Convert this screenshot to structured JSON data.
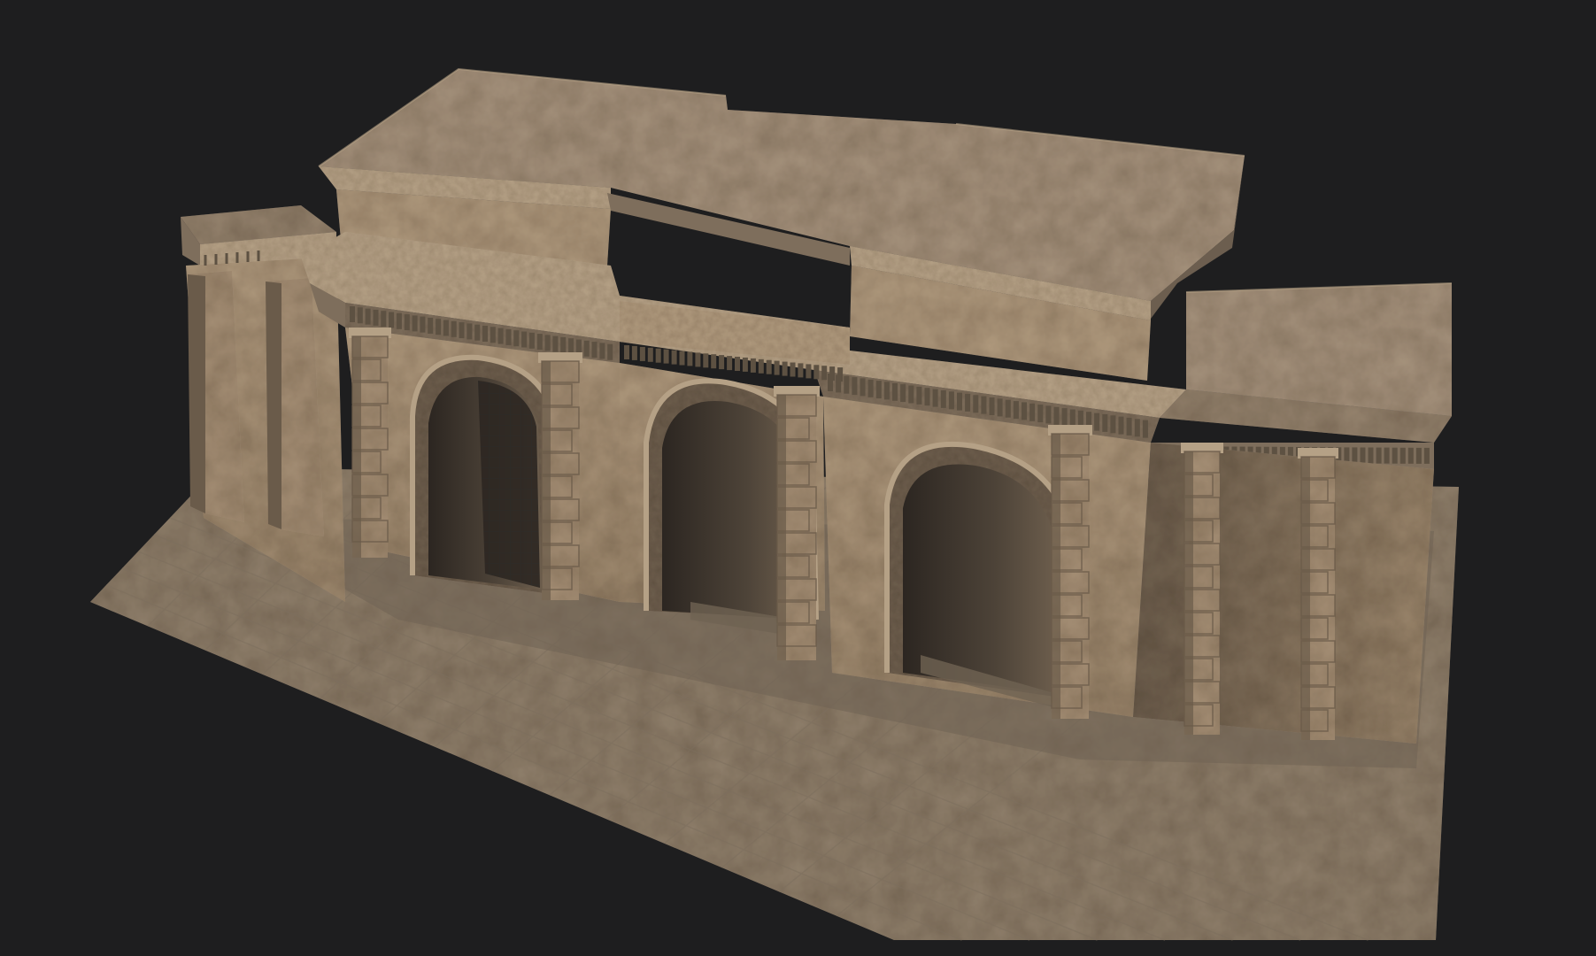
{
  "scene": {
    "subject": "stone-arched-gateway-3d-render",
    "colors": {
      "background": "#1e1e1f",
      "plaza_light": "#a6957f",
      "plaza_mid": "#8f7f6b",
      "plaza_dark": "#6f6353",
      "plaza_grout": "#7d6f5e",
      "roof_light": "#a5927c",
      "roof_mid": "#94826d",
      "roof_shadow": "#6c5e4f",
      "cornice_light": "#b5a186",
      "cornice_dark": "#7e6e5c",
      "wall_light": "#b09a7e",
      "wall_mid": "#9b866c",
      "wall_dark": "#6d5e4d",
      "pier_light": "#a58f75",
      "pier_dark": "#6a5b4a",
      "arch_void": "#4d4338",
      "arch_void_dark": "#2c2621",
      "iron_gate": "#2a2724",
      "dentil": "#5d5142"
    },
    "arches": [
      {
        "label": "left-arch",
        "has_gate": true
      },
      {
        "label": "center-arch",
        "has_gate": false
      },
      {
        "label": "right-arch",
        "has_gate": false
      }
    ]
  }
}
